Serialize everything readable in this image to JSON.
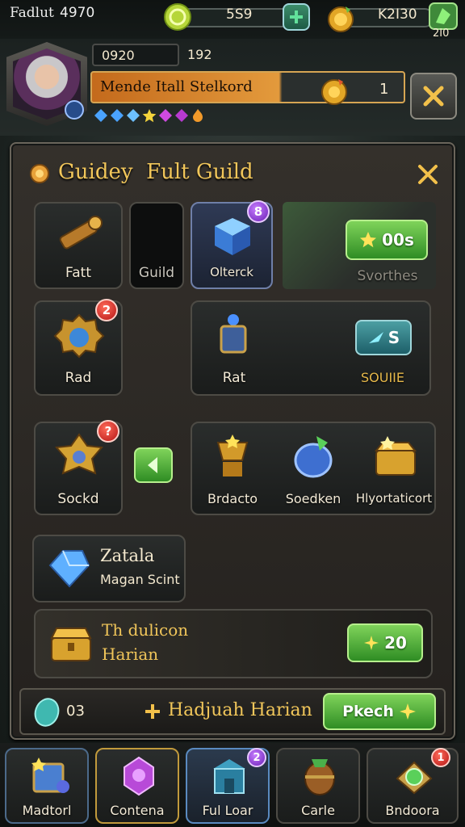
{
  "topbar": {
    "left_label": "Fadlut",
    "left_value": "4970",
    "coin_value": "5S9",
    "gold_value": "K2I30",
    "gem_sub": "2I0"
  },
  "player": {
    "id": "0920",
    "level": "192",
    "banner": "Mende Itall Stelkord",
    "banner_count": "1",
    "gems": [
      "blue",
      "blue",
      "blue",
      "yellow",
      "purple",
      "purple",
      "orange"
    ]
  },
  "panel": {
    "title": "Guidey  Fult Guild",
    "row1": {
      "item1": "Fatt",
      "item2": "Guild",
      "item3": "Olterck",
      "button": "00s",
      "sub": "Svorthes"
    },
    "row2": {
      "item1": "Rad",
      "badge1": "2",
      "item2": "Rat",
      "button": "S",
      "sub": "SOUIIE"
    },
    "row3": {
      "item1": "Sockd",
      "badge1": "?",
      "items": [
        "Brdacto",
        "Soedken",
        "Hlyortaticort"
      ]
    },
    "zatala": {
      "title": "Zatala",
      "subtitle": "Magan Scint"
    },
    "daily": {
      "title": "Th dulicon",
      "subtitle": "Harian",
      "button": "20"
    },
    "footer": {
      "count": "03",
      "label": "Hadjuah Harian",
      "button": "Pkech"
    }
  },
  "bottom_nav": [
    {
      "label": "Madtorl",
      "icon": "crate-icon"
    },
    {
      "label": "Contena",
      "icon": "crystal-icon"
    },
    {
      "label": "Ful Loar",
      "icon": "shop-icon",
      "badge": "2"
    },
    {
      "label": "Carle",
      "icon": "barrel-icon"
    },
    {
      "label": "Bndoora",
      "icon": "gem-chest-icon",
      "badge": "1"
    }
  ],
  "colors": {
    "accent_gold": "#e8b64a",
    "button_green": "#3c9a2a",
    "banner_orange": "#c46a1c"
  }
}
